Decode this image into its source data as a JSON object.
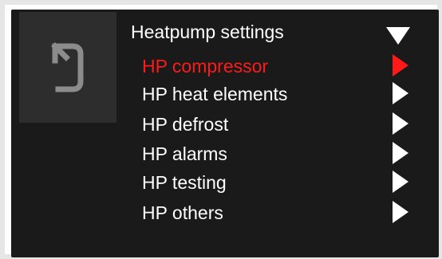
{
  "menu": {
    "title": "Heatpump settings",
    "items": [
      {
        "label": "HP compressor",
        "active": true
      },
      {
        "label": "HP heat elements",
        "active": false
      },
      {
        "label": "HP defrost",
        "active": false
      },
      {
        "label": "HP alarms",
        "active": false
      },
      {
        "label": "HP testing",
        "active": false
      },
      {
        "label": "HP others",
        "active": false
      }
    ]
  },
  "icons": {
    "back": "back-arrow-icon",
    "collapse": "triangle-down-icon",
    "item_arrow": "triangle-right-icon"
  },
  "colors": {
    "screen_bg": "#1a1a1a",
    "panel_bg": "#2d2d2d",
    "text": "#ffffff",
    "active": "#ff1a1a",
    "back_icon": "#8c8c8c"
  }
}
